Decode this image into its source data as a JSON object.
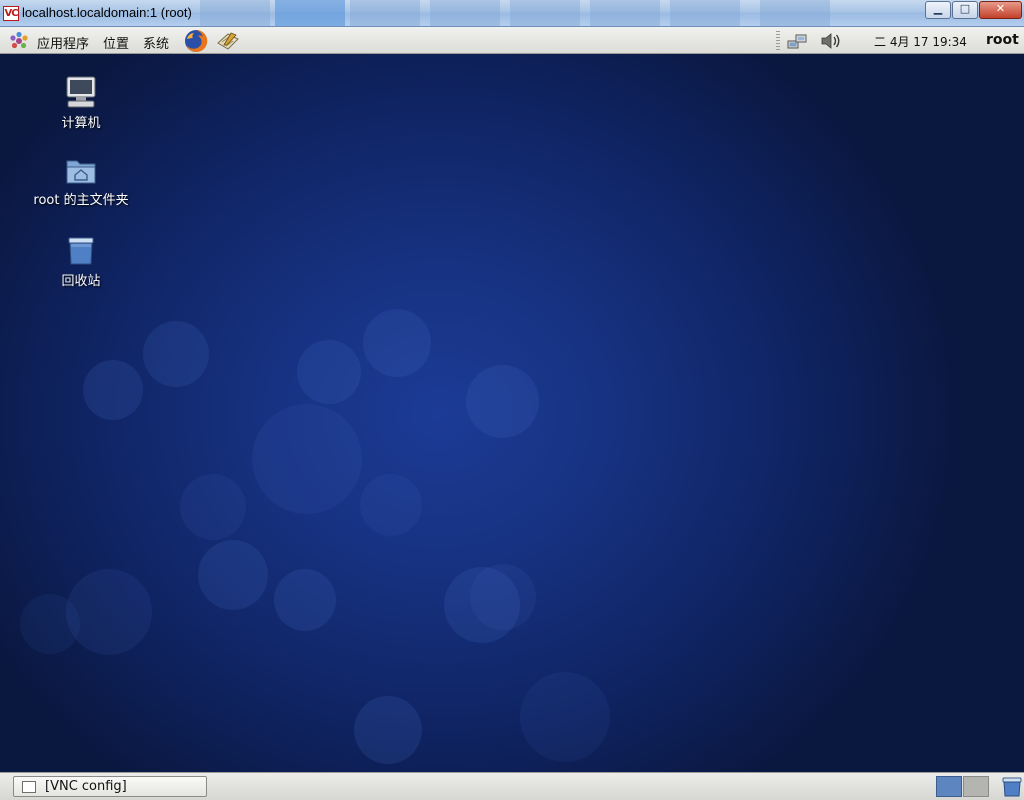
{
  "window": {
    "title": "localhost.localdomain:1 (root)",
    "app_icon": "VC",
    "buttons": {
      "minimize": "▁",
      "maximize": "□",
      "close": "✕"
    }
  },
  "top_panel": {
    "menus": {
      "applications": "应用程序",
      "places": "位置",
      "system": "系统"
    },
    "launchers": [
      "firefox-icon",
      "text-editor-icon"
    ],
    "clock": "二 4月 17 19:34",
    "user": "root"
  },
  "desktop": {
    "icons": [
      {
        "label": "计算机",
        "icon": "computer-icon"
      },
      {
        "label": "root 的主文件夹",
        "icon": "home-folder-icon"
      },
      {
        "label": "回收站",
        "icon": "trash-icon"
      }
    ]
  },
  "bottom_panel": {
    "taskbar_item": "[VNC config]",
    "workspaces": 2
  },
  "colors": {
    "desktop_center": "#1c3b96",
    "desktop_edge": "#0a173f",
    "workspace_active": "#5d86c0"
  }
}
